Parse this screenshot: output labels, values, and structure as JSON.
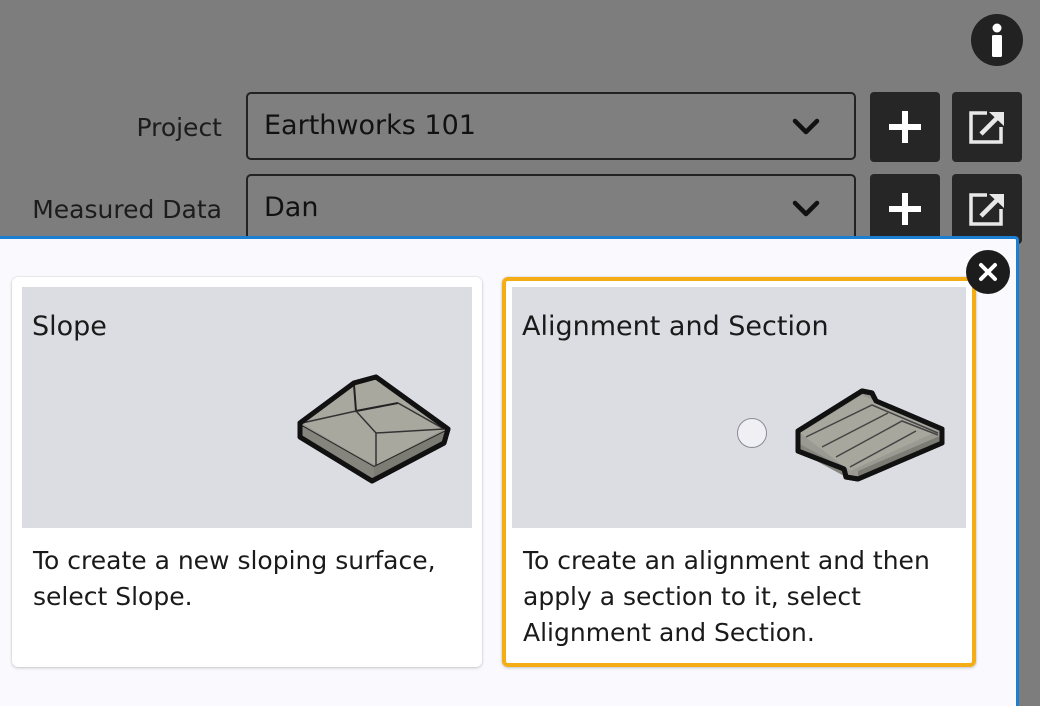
{
  "form": {
    "project": {
      "label": "Project",
      "value": "Earthworks 101"
    },
    "measured_data": {
      "label": "Measured Data",
      "value": "Dan"
    }
  },
  "dialog": {
    "cards": [
      {
        "title": "Slope",
        "description": "To create a new sloping surface, select Slope.",
        "icon": "slope-surface-icon",
        "selected": false
      },
      {
        "title": "Alignment and Section",
        "description": "To create an alignment and then apply a section to it, select Alignment and Section.",
        "icon": "alignment-section-icon",
        "selected": true
      }
    ]
  },
  "colors": {
    "selection_border": "#f5ad16",
    "dialog_border": "#1d7fd4",
    "backdrop": "#7d7d7d"
  }
}
